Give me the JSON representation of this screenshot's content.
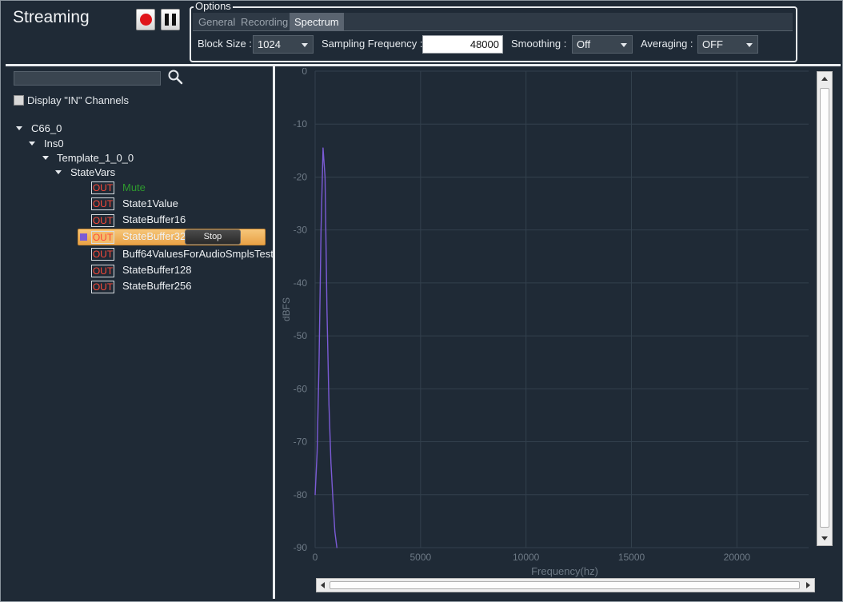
{
  "app": {
    "title": "Streaming"
  },
  "toolbar": {
    "record_icon": "record-icon",
    "pause_icon": "pause-icon"
  },
  "options": {
    "legend": "Options",
    "tabs": [
      {
        "label": "General",
        "active": false
      },
      {
        "label": "Recording",
        "active": false
      },
      {
        "label": "Spectrum",
        "active": true
      }
    ],
    "block_size": {
      "label": "Block Size :",
      "value": "1024"
    },
    "sampling_frequency": {
      "label": "Sampling Frequency :",
      "value": "48000"
    },
    "smoothing": {
      "label": "Smoothing :",
      "value": "Off"
    },
    "averaging": {
      "label": "Averaging :",
      "value": "OFF"
    }
  },
  "left_panel": {
    "search": {
      "placeholder": "",
      "icon": "search-icon"
    },
    "display_in_channels": {
      "label": "Display \"IN\" Channels",
      "checked": false
    },
    "tree": {
      "root": "C66_0",
      "instance": "Ins0",
      "template": "Template_1_0_0",
      "group": "StateVars",
      "items": [
        {
          "badge": "OUT",
          "label": "Mute",
          "color": "#2e9a2e",
          "selected": false
        },
        {
          "badge": "OUT",
          "label": "State1Value",
          "selected": false
        },
        {
          "badge": "OUT",
          "label": "StateBuffer16",
          "selected": false
        },
        {
          "badge": "OUT",
          "label": "StateBuffer32",
          "selected": true
        },
        {
          "badge": "OUT",
          "label": "Buff64ValuesForAudioSmplsTest",
          "selected": false
        },
        {
          "badge": "OUT",
          "label": "StateBuffer128",
          "selected": false
        },
        {
          "badge": "OUT",
          "label": "StateBuffer256",
          "selected": false
        }
      ],
      "stop_label": "Stop"
    }
  },
  "colors": {
    "background": "#1f2a36",
    "series": "#7b5bd6",
    "grid": "#33404d",
    "badge_text": "#ff4a3a",
    "selection": "#f0b35e"
  },
  "chart_data": {
    "type": "line",
    "xlabel": "Frequency(hz)",
    "ylabel": "dBFS",
    "xlim": [
      0,
      23400
    ],
    "ylim": [
      -90,
      0
    ],
    "xticks": [
      0,
      5000,
      10000,
      15000,
      20000
    ],
    "yticks": [
      0,
      -10,
      -20,
      -30,
      -40,
      -50,
      -60,
      -70,
      -80,
      -90
    ],
    "grid": true,
    "series": [
      {
        "color": "#7b5bd6",
        "x": [
          0,
          94,
          187,
          281,
          375,
          469,
          562,
          656,
          750,
          844,
          938,
          1031
        ],
        "y": [
          -80,
          -72,
          -55,
          -30,
          -14.5,
          -20,
          -45,
          -63,
          -74,
          -81,
          -87,
          -90
        ]
      }
    ]
  }
}
